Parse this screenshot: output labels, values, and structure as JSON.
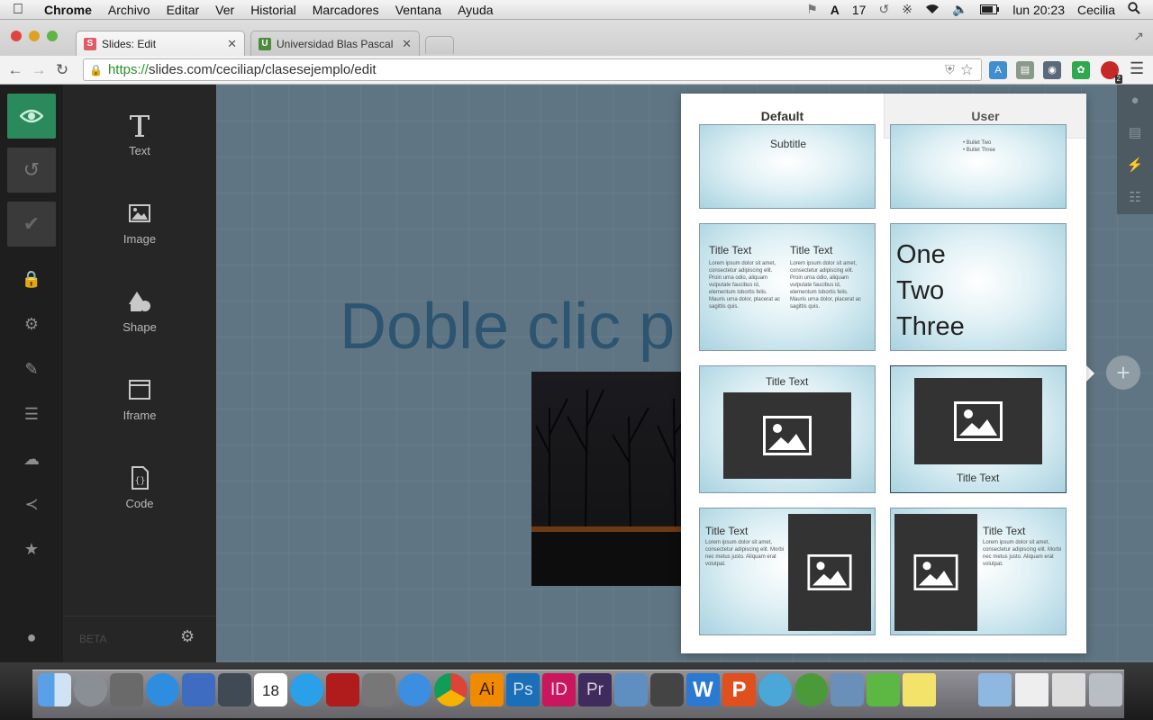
{
  "menubar": {
    "app": "Chrome",
    "items": [
      "Archivo",
      "Editar",
      "Ver",
      "Historial",
      "Marcadores",
      "Ventana",
      "Ayuda"
    ],
    "status": {
      "adobe_count": "17",
      "clock": "lun 20:23",
      "user": "Cecilia"
    }
  },
  "browser": {
    "tabs": [
      {
        "title": "Slides: Edit",
        "favicon": "S"
      },
      {
        "title": "Universidad Blas Pascal - (",
        "favicon": "U"
      }
    ],
    "url": {
      "scheme": "https://",
      "rest": "slides.com/ceciliap/clasesejemplo/edit"
    },
    "badge": "2"
  },
  "tools": {
    "items": [
      "Text",
      "Image",
      "Shape",
      "Iframe",
      "Code"
    ],
    "beta": "BETA"
  },
  "canvas": {
    "slide_title": "Doble clic p"
  },
  "panel": {
    "tabs": [
      "Default",
      "User"
    ],
    "thumbs": {
      "subtitle": "Subtitle",
      "bullets": [
        "Bullet Two",
        "Bullet Three"
      ],
      "title_text": "Title Text",
      "lorem_long": "Lorem ipsum dolor sit amet, consectetur adipiscing elit. Proin urna odio, aliquam vulputate faucibus id, elementum lobortis felis. Mauris urna dolor, placerat ac sagittis quis.",
      "lorem_short": "Lorem ipsum dolor sit amet, consectetur adipiscing elit. Morbi nec metus justo. Aliquam erat volutpat.",
      "one": "One",
      "two": "Two",
      "three": "Three"
    }
  },
  "colors": {
    "accent_green": "#2a8a5c",
    "canvas_bg": "#5f7583",
    "title_blue": "#2d5470"
  }
}
